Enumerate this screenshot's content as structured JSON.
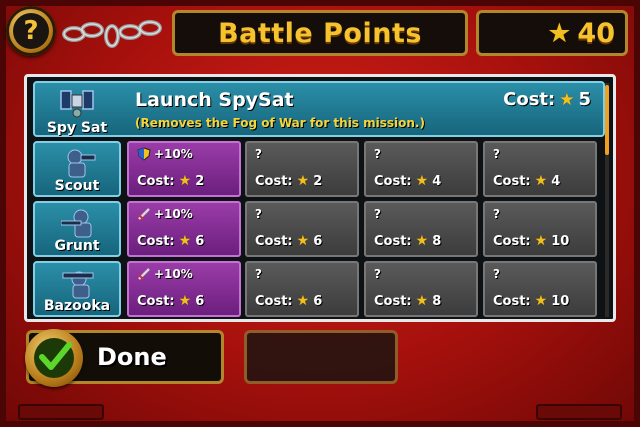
{
  "header": {
    "title": "Battle Points",
    "points": "40"
  },
  "spysat": {
    "unit_label": "Spy Sat",
    "name": "Launch SpySat",
    "description": "(Removes the Fog of War for this mission.)",
    "cost_label": "Cost:",
    "cost_value": "5"
  },
  "units": [
    {
      "label": "Scout",
      "upgrades": [
        {
          "bonus": "+10%",
          "icon": "shield-icon",
          "cost_label": "Cost:",
          "cost": "2",
          "owned": true
        },
        {
          "bonus": "?",
          "cost_label": "Cost:",
          "cost": "2",
          "owned": false
        },
        {
          "bonus": "?",
          "cost_label": "Cost:",
          "cost": "4",
          "owned": false
        },
        {
          "bonus": "?",
          "cost_label": "Cost:",
          "cost": "4",
          "owned": false
        }
      ]
    },
    {
      "label": "Grunt",
      "upgrades": [
        {
          "bonus": "+10%",
          "icon": "sword-icon",
          "cost_label": "Cost:",
          "cost": "6",
          "owned": true
        },
        {
          "bonus": "?",
          "cost_label": "Cost:",
          "cost": "6",
          "owned": false
        },
        {
          "bonus": "?",
          "cost_label": "Cost:",
          "cost": "8",
          "owned": false
        },
        {
          "bonus": "?",
          "cost_label": "Cost:",
          "cost": "10",
          "owned": false
        }
      ]
    },
    {
      "label": "Bazooka",
      "upgrades": [
        {
          "bonus": "+10%",
          "icon": "sword-icon",
          "cost_label": "Cost:",
          "cost": "6",
          "owned": true
        },
        {
          "bonus": "?",
          "cost_label": "Cost:",
          "cost": "6",
          "owned": false
        },
        {
          "bonus": "?",
          "cost_label": "Cost:",
          "cost": "8",
          "owned": false
        },
        {
          "bonus": "?",
          "cost_label": "Cost:",
          "cost": "10",
          "owned": false
        }
      ]
    }
  ],
  "footer": {
    "done_label": "Done"
  },
  "colors": {
    "accent_gold": "#f6c32e",
    "owned_purple": "#9a3ca8",
    "row_teal": "#2b8fa8",
    "background_red": "#c41a14"
  }
}
